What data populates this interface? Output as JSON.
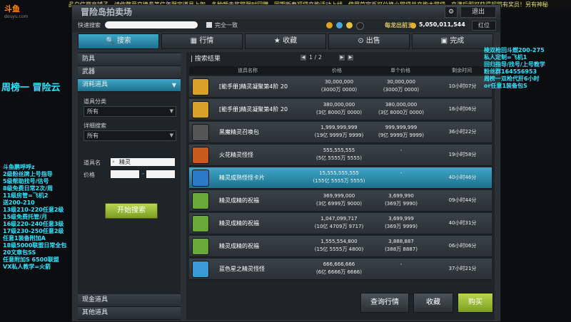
{
  "ticker": "品白信誉商铺子，请作弊意交换券等信年限定道具上架，多种颜击奖猫限时回赠，同期新春福袋充能活动上线，使用首宝币可兑换小猫袋并充能大猫袋，充满后即可获得超猫有奖员！另有神秘",
  "logo": {
    "name": "斗鱼",
    "sub": "douyu.com"
  },
  "window": {
    "title": "冒险岛拍卖场",
    "close_label": "退出",
    "settings_icon": "gear-icon"
  },
  "searchbar": {
    "label": "快速搜索",
    "exact_label": "完全一致",
    "status": "每龙出前五",
    "money": "5,050,011,544",
    "position_btn": "红位"
  },
  "tabs": [
    {
      "label": "搜索",
      "icon": "search-icon"
    },
    {
      "label": "行情",
      "icon": "chart-icon"
    },
    {
      "label": "收藏",
      "icon": "star-icon"
    },
    {
      "label": "出售",
      "icon": "sell-icon"
    },
    {
      "label": "完成",
      "icon": "check-icon"
    }
  ],
  "sidebar": {
    "categories": [
      "防具",
      "武器",
      "消耗道具"
    ],
    "filters": [
      {
        "label": "道具分类",
        "value": "所有"
      },
      {
        "label": "详细搜索",
        "value": "所有"
      }
    ],
    "name_label": "道具名",
    "name_value": "精灵",
    "price_label": "价格",
    "price_sep": "-",
    "start_btn": "开始搜索",
    "bottom_categories": [
      "现金道具",
      "其他道具"
    ]
  },
  "results": {
    "title": "搜索结果",
    "page": "1 / 2",
    "headers": [
      "道具名称",
      "价格",
      "单个价格",
      "剩余时间"
    ],
    "rows": [
      {
        "name": "[能手册]精灵凝聚第4阶 20",
        "price1": "30,000,000",
        "price2": "(3000万 0000)",
        "unit1": "30,000,000",
        "unit2": "(3000万 0000)",
        "time": "10小时07分",
        "icon": "book-icon",
        "color": "#d7a12a"
      },
      {
        "name": "[能手册]精灵凝聚第4阶 20",
        "price1": "380,000,000",
        "price2": "(3亿 8000万 0000)",
        "unit1": "380,000,000",
        "unit2": "(3亿 8000万 0000)",
        "time": "16小时06分",
        "icon": "book-icon",
        "color": "#d7a12a"
      },
      {
        "name": "黑魔精灵召唤包",
        "price1": "1,999,999,999",
        "price2": "(19亿 9999万 9999)",
        "unit1": "999,999,999",
        "unit2": "(9亿 9999万 9999)",
        "time": "36小时22分",
        "icon": "bag-icon",
        "color": "#555"
      },
      {
        "name": "火花精灵怪怪",
        "price1": "555,555,555",
        "price2": "(5亿 5555万 5555)",
        "unit1": "-",
        "unit2": "",
        "time": "19小时58分",
        "icon": "spark-icon",
        "color": "#c85a1c"
      },
      {
        "name": "精灵成熟怪怪卡片",
        "price1": "15,555,555,555",
        "price2": "(155亿 5555万 5555)",
        "unit1": "-",
        "unit2": "",
        "time": "40小时46分",
        "icon": "card-icon",
        "color": "#2a7ac8"
      },
      {
        "name": "精灵成精的祝福",
        "price1": "369,999,000",
        "price2": "(3亿 6999万 9000)",
        "unit1": "3,699,990",
        "unit2": "(369万 9990)",
        "time": "09小时44分",
        "icon": "bless-icon",
        "color": "#6aa83a"
      },
      {
        "name": "精灵成精的祝福",
        "price1": "1,047,099,717",
        "price2": "(10亿 4709万 9717)",
        "unit1": "3,699,999",
        "unit2": "(369万 9999)",
        "time": "40小时31分",
        "icon": "bless-icon",
        "color": "#6aa83a"
      },
      {
        "name": "精灵成精的祝福",
        "price1": "1,555,554,800",
        "price2": "(15亿 5555万 4800)",
        "unit1": "3,888,887",
        "unit2": "(388万 8887)",
        "time": "06小时06分",
        "icon": "bless-icon",
        "color": "#6aa83a"
      },
      {
        "name": "蓝色星之精灵怪怪",
        "price1": "666,666,666",
        "price2": "(6亿 6666万 6666)",
        "unit1": "-",
        "unit2": "",
        "time": "37小时21分",
        "icon": "star-monster-icon",
        "color": "#3a9ad8"
      }
    ],
    "buttons": {
      "query": "查询行情",
      "favorite": "收藏",
      "buy": "购买"
    }
  },
  "overlays": {
    "big_left": "周榜一 冒险云",
    "left_lines": [
      "斗鱼鹏呼呼z",
      "2级粉丝牌上号指导",
      "5级帮助找号/估号",
      "8级免费日常2次/周",
      "11级房管=飞机2",
      "送200-210",
      "13级210-220任意2级",
      "15级免费托管/月",
      "16级220-240任意3级",
      "17级230-250任意2级",
      "任意1装备附加A",
      "18级5000联盟日常全包",
      "20文章包SS",
      "任意附加S 6500联盟",
      "VX私人教学=火箭"
    ],
    "right_lines": [
      "棱双枪回斗燃200-275",
      "私人定制=飞机1",
      "回归指导/找号/上号教学",
      "粉丝群164556953",
      "周榜一双枪代肝6小时",
      "or任意1装备包S"
    ]
  }
}
